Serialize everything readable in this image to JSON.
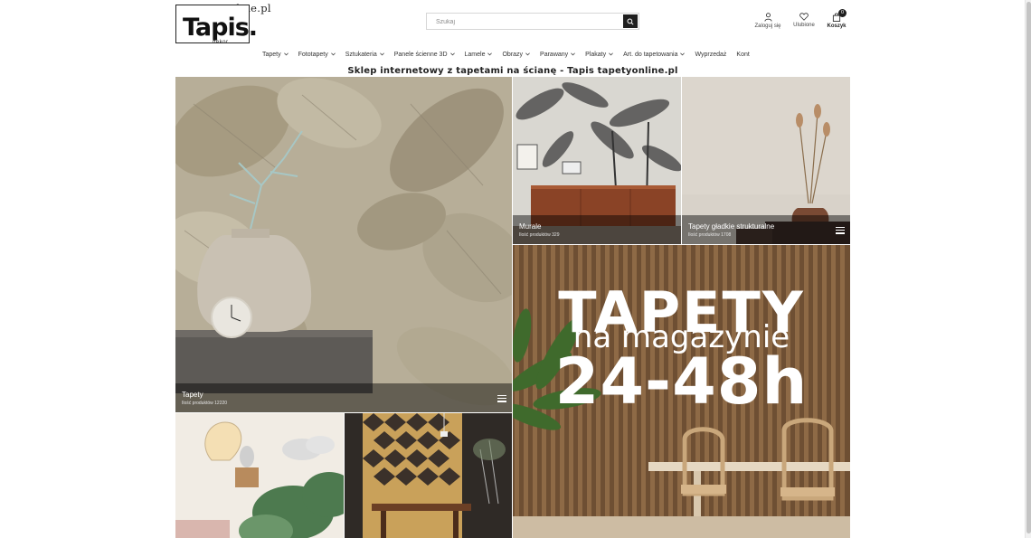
{
  "header": {
    "logo": {
      "domain": "tapetyonline.pl",
      "brand": "Tapis.",
      "sub": "dekor"
    },
    "search": {
      "placeholder": "Szukaj",
      "value": ""
    },
    "actions": {
      "login_label": "Zaloguj się",
      "favorites_label": "Ulubione",
      "cart_label": "Koszyk",
      "cart_count": "0"
    }
  },
  "nav": {
    "items": [
      {
        "label": "Tapety",
        "has_dropdown": true
      },
      {
        "label": "Fototapety",
        "has_dropdown": true
      },
      {
        "label": "Sztukateria",
        "has_dropdown": true
      },
      {
        "label": "Panele ścienne 3D",
        "has_dropdown": true
      },
      {
        "label": "Lamele",
        "has_dropdown": true
      },
      {
        "label": "Obrazy",
        "has_dropdown": true
      },
      {
        "label": "Parawany",
        "has_dropdown": true
      },
      {
        "label": "Plakaty",
        "has_dropdown": true
      },
      {
        "label": "Art. do tapetowania",
        "has_dropdown": true
      },
      {
        "label": "Wyprzedaż",
        "has_dropdown": false
      },
      {
        "label": "Kont",
        "has_dropdown": false
      }
    ]
  },
  "main": {
    "heading": "Sklep internetowy z tapetami na ścianę - Tapis tapetyonline.pl",
    "tiles": {
      "tapety": {
        "name": "Tapety",
        "count": "Ilość produktów 12220"
      },
      "murale": {
        "name": "Murale",
        "count": "Ilość produktów 329"
      },
      "gladkie": {
        "name": "Tapety gładkie strukturalne",
        "count": "Ilość produktów 1708"
      },
      "promo": {
        "line1": "TAPETY",
        "line2": "na magazynie",
        "line3": "24-48h"
      }
    }
  },
  "icons": {
    "search": "search-icon",
    "user": "user-icon",
    "heart": "heart-icon",
    "bag": "shopping-bag-icon",
    "chevron": "chevron-down-icon",
    "menu": "hamburger-icon"
  },
  "colors": {
    "dark": "#1f1f1f",
    "caption_overlay": "#000000",
    "promo_slats": "#7a5a3a"
  }
}
